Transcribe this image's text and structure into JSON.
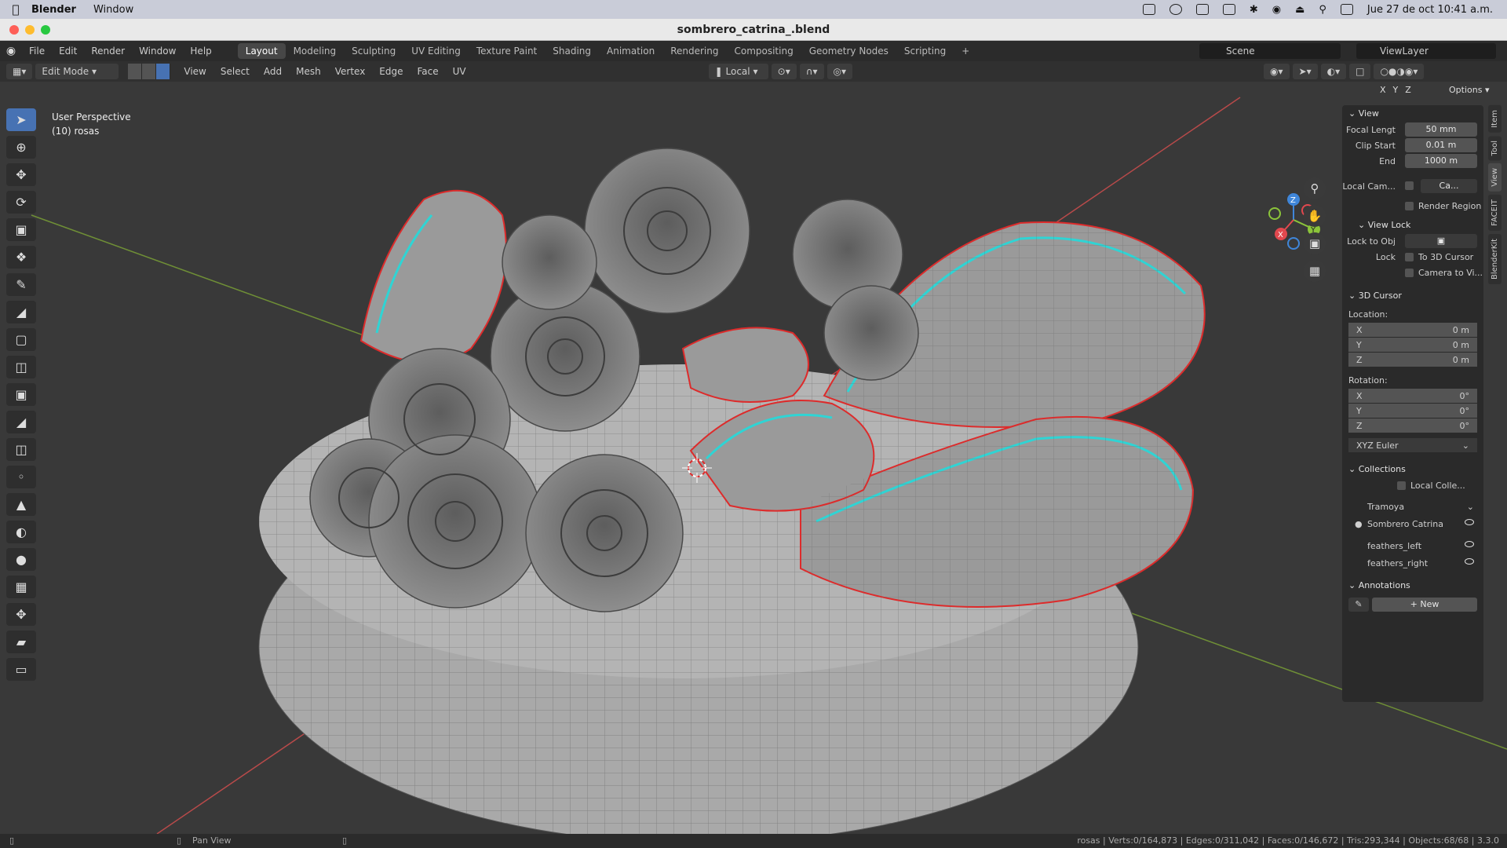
{
  "macos": {
    "app_name": "Blender",
    "menu": [
      "Window"
    ],
    "datetime": "Jue 27 de oct  10:41 a.m."
  },
  "window": {
    "title": "sombrero_catrina_.blend"
  },
  "topbar": {
    "menus": [
      "File",
      "Edit",
      "Render",
      "Window",
      "Help"
    ],
    "workspaces": [
      "Layout",
      "Modeling",
      "Sculpting",
      "UV Editing",
      "Texture Paint",
      "Shading",
      "Animation",
      "Rendering",
      "Compositing",
      "Geometry Nodes",
      "Scripting"
    ],
    "active_workspace": "Layout",
    "add_tab": "+",
    "scene": "Scene",
    "view_layer": "ViewLayer"
  },
  "header": {
    "mode": "Edit Mode",
    "menus": [
      "View",
      "Select",
      "Add",
      "Mesh",
      "Vertex",
      "Edge",
      "Face",
      "UV"
    ],
    "orientation": "Local",
    "options": "Options",
    "axes": [
      "X",
      "Y",
      "Z"
    ]
  },
  "viewport": {
    "perspective": "User Perspective",
    "object": "(10) rosas",
    "axis_colors": {
      "x": "#e2484e",
      "y": "#8bc43a",
      "z": "#3f86d9"
    }
  },
  "npanel": {
    "tabs": [
      "Item",
      "Tool",
      "View",
      "FACEIT",
      "BlenderKit"
    ],
    "view_title": "View",
    "focal_label": "Focal Lengt",
    "focal_value": "50 mm",
    "clip_start_label": "Clip Start",
    "clip_start_value": "0.01 m",
    "end_label": "End",
    "end_value": "1000 m",
    "local_cam_label": "Local Cam...",
    "local_cam_value": "Ca...",
    "render_region": "Render Region",
    "view_lock_title": "View Lock",
    "lock_obj_label": "Lock to Obj",
    "lock_label": "Lock",
    "to_cursor": "To 3D Cursor",
    "camera_to_view": "Camera to Vi...",
    "cursor_title": "3D Cursor",
    "location_label": "Location:",
    "location": [
      {
        "a": "X",
        "v": "0 m"
      },
      {
        "a": "Y",
        "v": "0 m"
      },
      {
        "a": "Z",
        "v": "0 m"
      }
    ],
    "rotation_label": "Rotation:",
    "rotation": [
      {
        "a": "X",
        "v": "0°"
      },
      {
        "a": "Y",
        "v": "0°"
      },
      {
        "a": "Z",
        "v": "0°"
      }
    ],
    "rotation_mode": "XYZ Euler",
    "collections_title": "Collections",
    "local_collections": "Local Colle...",
    "collections": [
      "Tramoya",
      "Sombrero Catrina",
      "feathers_left",
      "feathers_right"
    ],
    "annotations_title": "Annotations",
    "new_label": "New"
  },
  "status": {
    "pan": "Pan View",
    "stats": "rosas | Verts:0/164,873 | Edges:0/311,042 | Faces:0/146,672 | Tris:293,344 | Objects:68/68 | 3.3.0"
  }
}
